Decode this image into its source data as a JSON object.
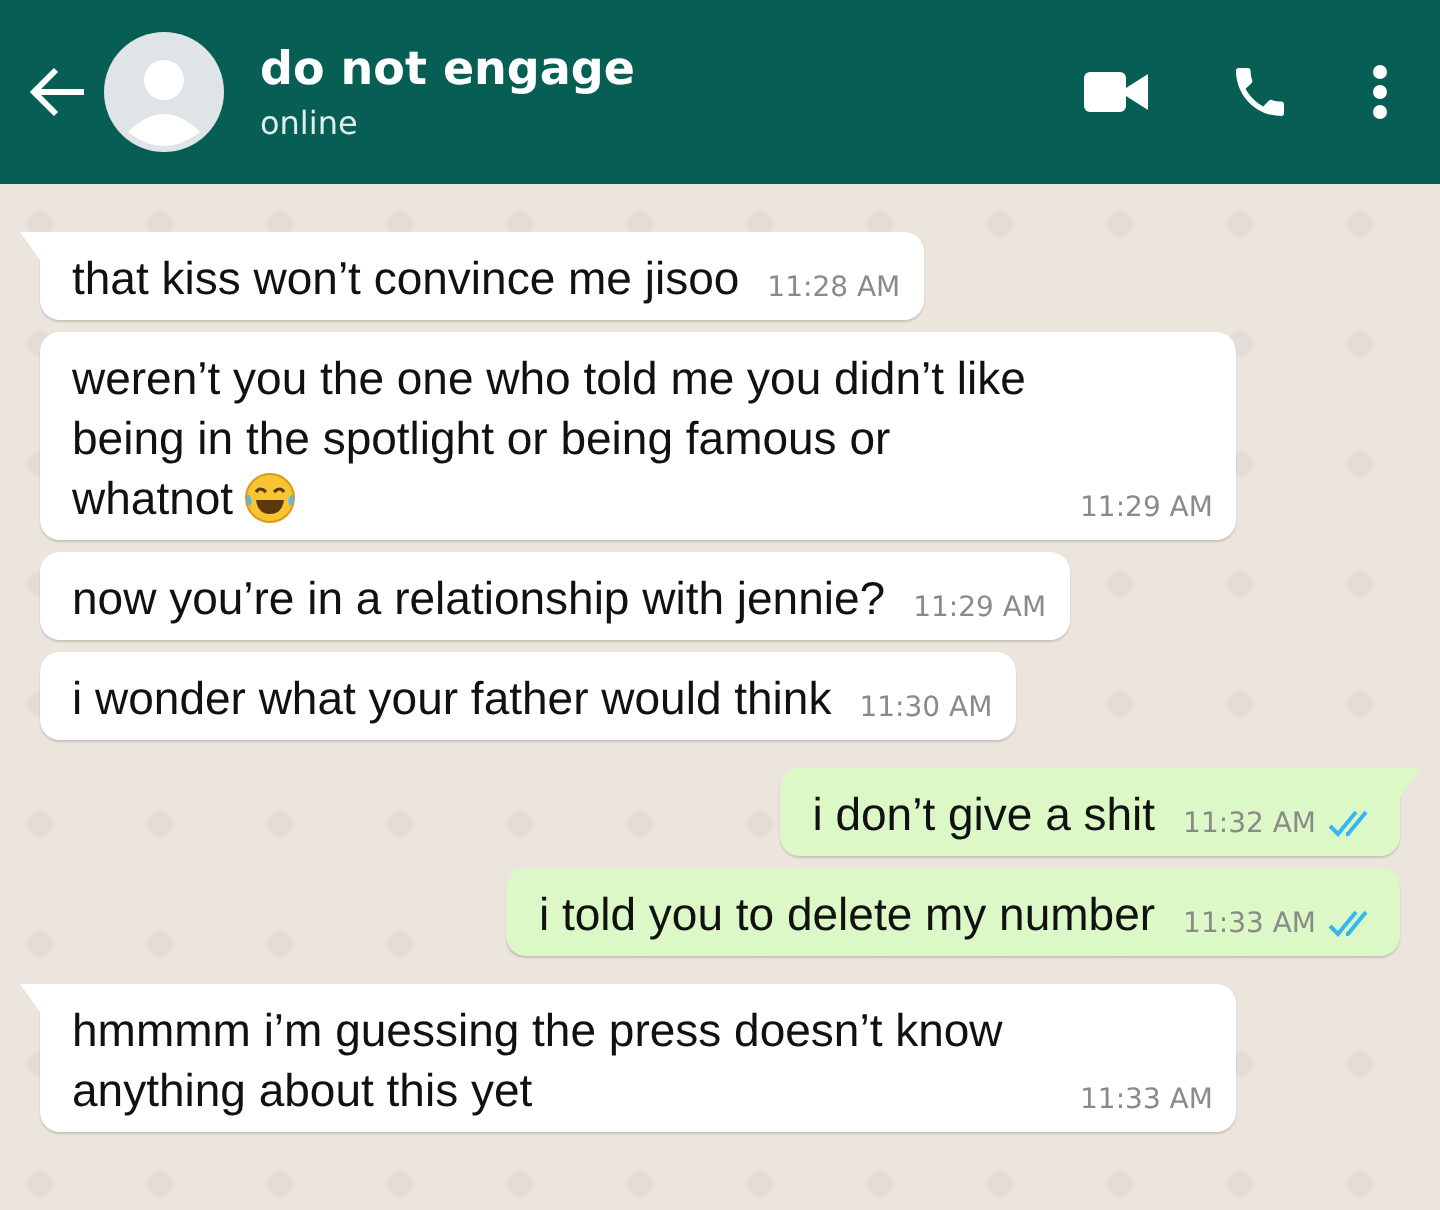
{
  "header": {
    "title": "do not engage",
    "status": "online"
  },
  "messages": [
    {
      "kind": "incoming",
      "text": "that kiss won’t convince me jisoo",
      "time": "11:28 AM",
      "tail": true
    },
    {
      "kind": "incoming",
      "text": "weren’t you the one who told me you didn’t like being in the spotlight or being famous or whatnot",
      "time": "11:29 AM",
      "tail": false,
      "has_emoji": true
    },
    {
      "kind": "incoming",
      "text": "now you’re in a relationship with jennie?",
      "time": "11:29 AM",
      "tail": false
    },
    {
      "kind": "incoming",
      "text": "i wonder what your father would think",
      "time": "11:30 AM",
      "tail": false
    },
    {
      "kind": "outgoing",
      "text": "i don’t give a shit",
      "time": "11:32 AM",
      "tail": true,
      "read": true
    },
    {
      "kind": "outgoing",
      "text": "i told you to delete my number",
      "time": "11:33 AM",
      "tail": false,
      "read": true
    },
    {
      "kind": "incoming",
      "text": "hmmmm i’m guessing the press doesn’t know anything about this yet",
      "time": "11:33 AM",
      "tail": true
    }
  ]
}
